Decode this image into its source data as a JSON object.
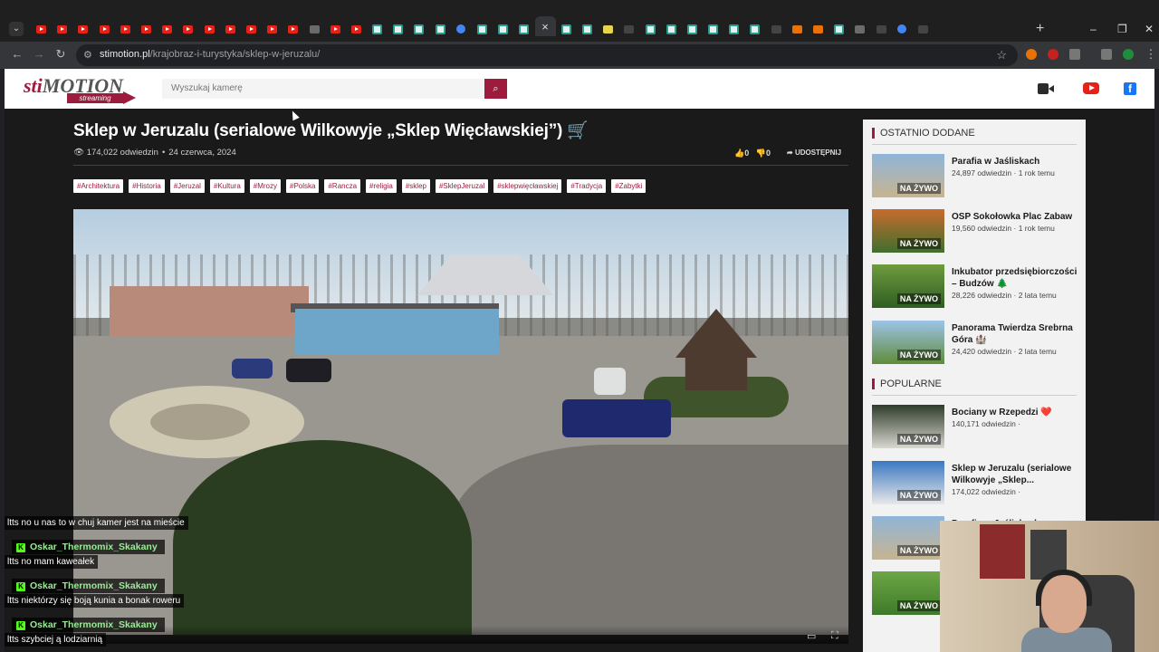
{
  "browser": {
    "tab_icons": [
      "yt",
      "yt",
      "yt",
      "yt",
      "yt",
      "yt",
      "yt",
      "yt",
      "yt",
      "yt",
      "yt",
      "yt",
      "yt",
      "misc",
      "yt",
      "yt",
      "st",
      "st",
      "st",
      "st",
      "gl",
      "st",
      "st",
      "st",
      "active",
      "st",
      "st",
      "yl",
      "gy",
      "st",
      "st",
      "st",
      "st",
      "st",
      "st",
      "gy",
      "or",
      "or",
      "st",
      "misc",
      "gy",
      "gl",
      "gy"
    ],
    "active_tab_close": "×",
    "new_tab": "+",
    "minimize": "–",
    "restore": "❐",
    "close": "✕",
    "url_host": "stimotion.pl",
    "url_path": "/krajobraz-i-turystyka/sklep-w-jeruzalu/"
  },
  "site": {
    "logo_text_1": "sti",
    "logo_text_2": "MOTION",
    "logo_streaming": "streaming",
    "search_placeholder": "Wyszukaj kamerę",
    "colors": {
      "brand": "#9d1c3d",
      "youtube": "#e62117",
      "facebook": "#1877f2"
    }
  },
  "article": {
    "title": "Sklep w Jeruzalu (serialowe Wilkowyje „Sklep Więcławskiej”) 🛒",
    "views": "174,022 odwiedzin",
    "date": "24 czerwca, 2024",
    "likes": "0",
    "dislikes": "0",
    "share": "UDOSTĘPNIJ",
    "tags": [
      "#Architektura",
      "#Historia",
      "#Jeruzal",
      "#Kultura",
      "#Mrozy",
      "#Polska",
      "#Rancza",
      "#religia",
      "#sklep",
      "#SklepJeruzal",
      "#sklepwięcławskiej",
      "#Tradycja",
      "#Zabytki"
    ]
  },
  "sidebar": {
    "recent_title": "OSTATNIO DODANE",
    "popular_title": "POPULARNE",
    "live_badge": "NA ŻYWO",
    "recent": [
      {
        "name": "Parafia w Jaśliskach",
        "views": "24,897 odwiedzin · 1 rok temu"
      },
      {
        "name": "OSP Sokołowka Plac Zabaw",
        "views": "19,560 odwiedzin · 1 rok temu"
      },
      {
        "name": "Inkubator przedsiębiorczości – Budzów 🌲",
        "views": "28,226 odwiedzin · 2 lata temu"
      },
      {
        "name": "Panorama Twierdza Srebrna Góra 🏰",
        "views": "24,420 odwiedzin · 2 lata temu"
      }
    ],
    "popular": [
      {
        "name": "Bociany w Rzepedzi ❤️",
        "views": "140,171 odwiedzin ·"
      },
      {
        "name": "Sklep w Jeruzalu (serialowe Wilkowyje „Sklep...",
        "views": "174,022 odwiedzin ·"
      },
      {
        "name": "Parafia w Jaśliskach",
        "views": ""
      },
      {
        "name": "",
        "views": ""
      }
    ]
  },
  "chat": [
    {
      "user": "",
      "text": "ltts no u nas to w chuj kamer jest na mieście"
    },
    {
      "user": "Oskar_Thermomix_Skakany",
      "text": "ltts no mam kaweałek"
    },
    {
      "user": "Oskar_Thermomix_Skakany",
      "text": "ltts niektórzy się boją kunia a bonak roweru"
    },
    {
      "user": "Oskar_Thermomix_Skakany",
      "text": "ltts szybciej ą lodziarnią"
    }
  ]
}
